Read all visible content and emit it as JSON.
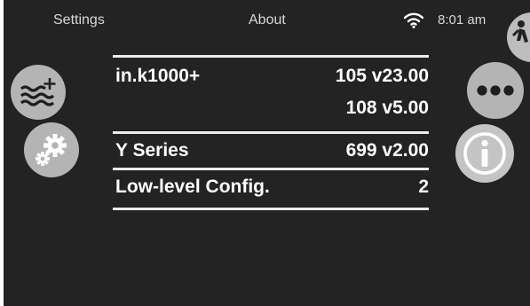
{
  "status_bar": {
    "left_label": "Settings",
    "title": "About",
    "time": "8:01 am",
    "wifi_icon": "wifi-icon"
  },
  "left_buttons": [
    {
      "icon": "water-add-icon"
    },
    {
      "icon": "gears-icon"
    }
  ],
  "right_buttons": [
    {
      "icon": "more-dots-icon"
    },
    {
      "icon": "info-icon"
    },
    {
      "icon": "person-icon"
    }
  ],
  "info_rows": [
    {
      "label": "in.k1000+",
      "values": [
        "105 v23.00",
        "108 v5.00"
      ]
    },
    {
      "label": "Y Series",
      "values": [
        "699 v2.00"
      ]
    },
    {
      "label": "Low-level Config.",
      "values": [
        "2"
      ]
    }
  ],
  "colors": {
    "screen_bg": "#232323",
    "button_gray": "#b4b4b4",
    "text": "#ffffff",
    "divider": "#ececec"
  }
}
